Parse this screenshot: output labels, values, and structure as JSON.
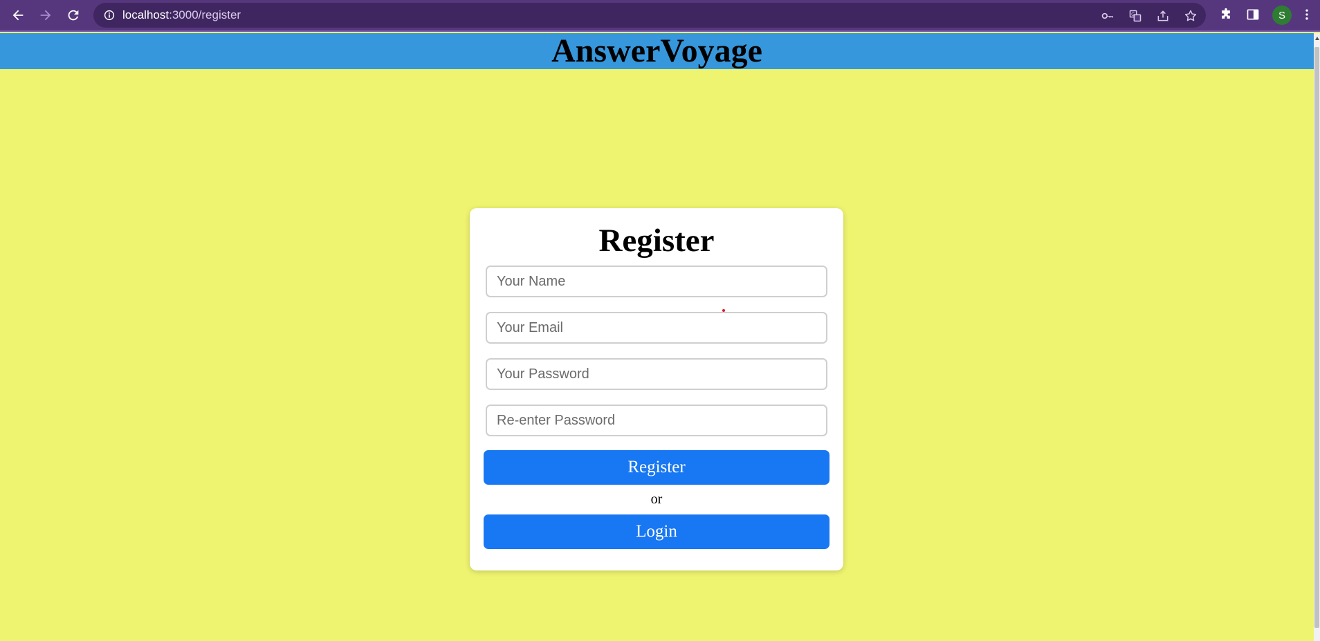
{
  "browser": {
    "url_host": "localhost",
    "url_path": ":3000/register",
    "profile_initial": "S",
    "icons": {
      "back": "arrow-left-icon",
      "forward": "arrow-right-icon",
      "reload": "reload-icon",
      "site_info": "info-circle-icon",
      "password": "key-icon",
      "translate": "translate-icon",
      "share": "share-icon",
      "bookmark": "star-icon",
      "extensions": "puzzle-icon",
      "side_panel": "side-panel-icon",
      "menu": "kebab-menu-icon"
    }
  },
  "header": {
    "title": "AnswerVoyage"
  },
  "register_form": {
    "title": "Register",
    "fields": {
      "name": {
        "placeholder": "Your Name",
        "value": ""
      },
      "email": {
        "placeholder": "Your Email",
        "value": ""
      },
      "password": {
        "placeholder": "Your Password",
        "value": ""
      },
      "confirm_password": {
        "placeholder": "Re-enter Password",
        "value": ""
      }
    },
    "register_button_label": "Register",
    "separator_text": "or",
    "login_button_label": "Login"
  },
  "colors": {
    "browser_frame": "#56377d",
    "omnibox": "#3f2660",
    "header_bg": "#3797dc",
    "page_bg": "#eef46f",
    "button_bg": "#1877f2",
    "avatar_bg": "#2e7d32"
  }
}
